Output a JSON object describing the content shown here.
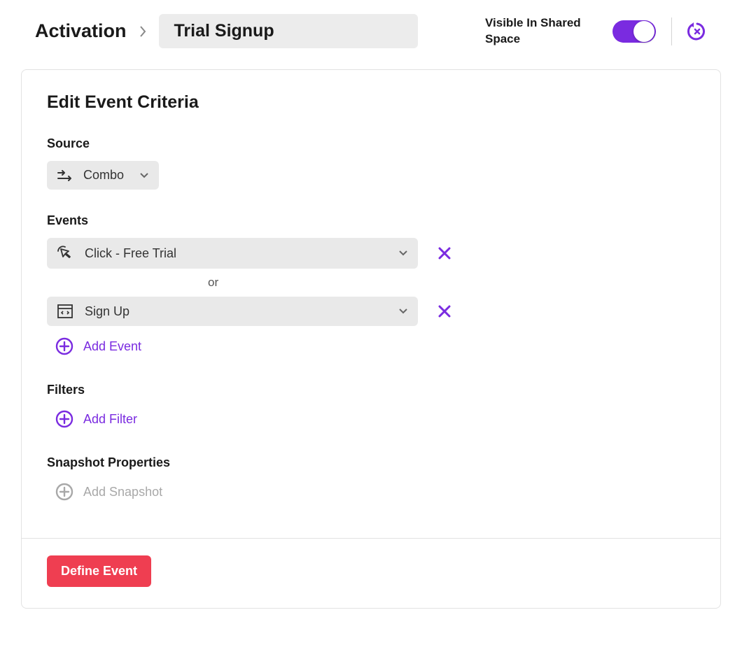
{
  "breadcrumb": {
    "root": "Activation",
    "current": "Trial Signup"
  },
  "header": {
    "visible_label": "Visible In Shared Space",
    "toggle_on": true
  },
  "card": {
    "title": "Edit Event Criteria",
    "source": {
      "label": "Source",
      "value": "Combo"
    },
    "events": {
      "label": "Events",
      "items": [
        {
          "icon": "cursor-click",
          "label": "Click - Free Trial"
        },
        {
          "icon": "code-window",
          "label": "Sign Up"
        }
      ],
      "or": "or",
      "add_label": "Add Event"
    },
    "filters": {
      "label": "Filters",
      "add_label": "Add Filter"
    },
    "snapshot": {
      "label": "Snapshot Properties",
      "add_label": "Add Snapshot"
    },
    "define_button": "Define Event"
  }
}
